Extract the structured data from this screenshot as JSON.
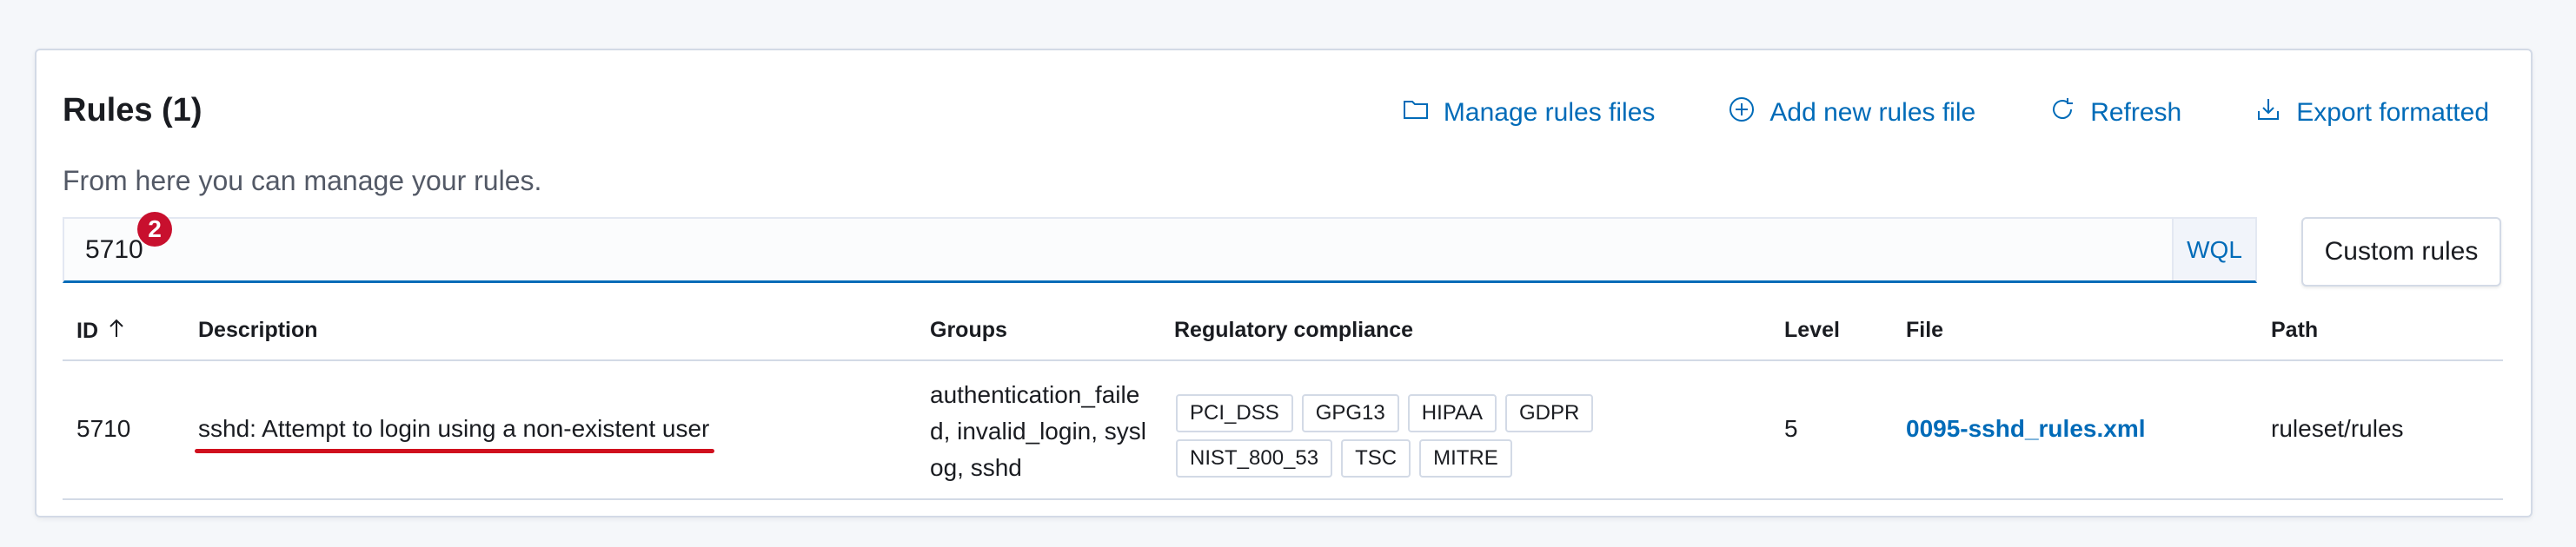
{
  "header": {
    "title": "Rules (1)",
    "subtitle": "From here you can manage your rules."
  },
  "actions": [
    {
      "label": "Manage rules files",
      "icon": "folder-icon"
    },
    {
      "label": "Add new rules file",
      "icon": "plus-circle-icon"
    },
    {
      "label": "Refresh",
      "icon": "refresh-icon"
    },
    {
      "label": "Export formatted",
      "icon": "export-icon"
    }
  ],
  "search": {
    "value": "5710",
    "badge": "2",
    "wql_label": "WQL"
  },
  "custom_rules_label": "Custom rules",
  "table": {
    "columns": [
      "ID",
      "Description",
      "Groups",
      "Regulatory compliance",
      "Level",
      "File",
      "Path"
    ],
    "rows": [
      {
        "id": "5710",
        "description": "sshd: Attempt to login using a non-existent user",
        "groups": "authentication_failed, invalid_login, syslog, sshd",
        "compliance": [
          "PCI_DSS",
          "GPG13",
          "HIPAA",
          "GDPR",
          "NIST_800_53",
          "TSC",
          "MITRE"
        ],
        "level": "5",
        "file": "0095-sshd_rules.xml",
        "path": "ruleset/rules"
      }
    ]
  },
  "colors": {
    "accent": "#006bb8",
    "badge": "#c8102e",
    "annotation_underline": "#d0101e"
  }
}
